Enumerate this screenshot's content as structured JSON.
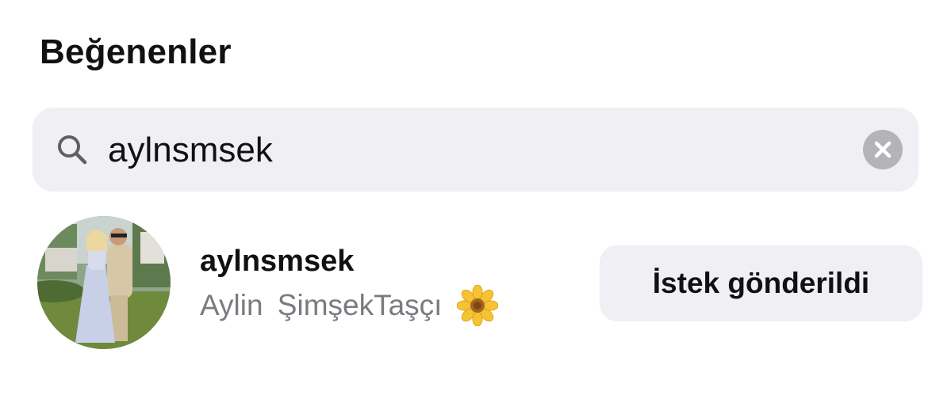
{
  "header": {
    "title": "Beğenenler"
  },
  "search": {
    "icon": "search-icon",
    "value": "aylnsmsek",
    "clear_icon": "clear-icon"
  },
  "results": [
    {
      "avatar": "profile-photo",
      "username": "aylnsmsek",
      "full_name": "Aylin  ŞimşekTaşçı",
      "name_emoji_icon": "sunflower-icon",
      "action_label": "İstek gönderildi"
    }
  ],
  "colors": {
    "search_bg": "#efeff4",
    "button_bg": "#efeff4",
    "secondary_text": "#7a7a80",
    "clear_icon_bg": "#b4b4b8"
  }
}
